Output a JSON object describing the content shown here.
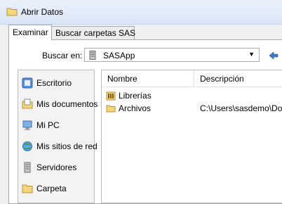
{
  "window": {
    "title": "Abrir Datos"
  },
  "tabs": [
    {
      "label": "Examinar"
    },
    {
      "label": "Buscar carpetas SAS"
    }
  ],
  "lookin": {
    "label": "Buscar en:",
    "value": "SASApp"
  },
  "places": [
    {
      "label": "Escritorio",
      "icon": "desktop-icon"
    },
    {
      "label": "Mis documentos",
      "icon": "documents-icon"
    },
    {
      "label": "Mi PC",
      "icon": "computer-icon"
    },
    {
      "label": "Mis sitios de red",
      "icon": "network-icon"
    },
    {
      "label": "Servidores",
      "icon": "server-icon"
    },
    {
      "label": "Carpeta",
      "icon": "folder-icon"
    }
  ],
  "list": {
    "columns": [
      "Nombre",
      "Descripción"
    ],
    "rows": [
      {
        "name": "Librerías",
        "desc": "",
        "icon": "library-icon"
      },
      {
        "name": "Archivos",
        "desc": "C:\\Users\\sasdemo\\Docu",
        "icon": "folder-icon"
      }
    ]
  },
  "colors": {
    "folder": "#f5d67a",
    "accent": "#3c78c4"
  }
}
